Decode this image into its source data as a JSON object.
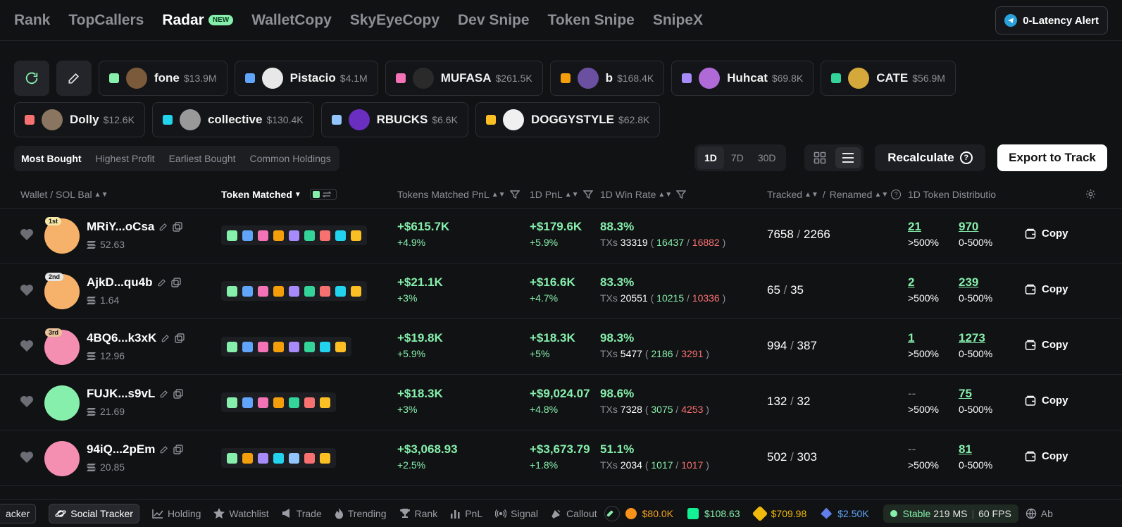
{
  "nav": {
    "items": [
      {
        "label": "Rank",
        "active": false
      },
      {
        "label": "TopCallers",
        "active": false
      },
      {
        "label": "Radar",
        "active": true,
        "badge": "NEW"
      },
      {
        "label": "WalletCopy",
        "active": false
      },
      {
        "label": "SkyEyeCopy",
        "active": false
      },
      {
        "label": "Dev Snipe",
        "active": false
      },
      {
        "label": "Token Snipe",
        "active": false
      },
      {
        "label": "SnipeX",
        "active": false
      }
    ],
    "alert_label": "0-Latency Alert"
  },
  "tokens": [
    {
      "name": "fone",
      "mc": "$13.9M",
      "color": "#86efac",
      "avatar": "#7a5a3a"
    },
    {
      "name": "Pistacio",
      "mc": "$4.1M",
      "color": "#60a5fa",
      "avatar": "#e8e8e8"
    },
    {
      "name": "MUFASA",
      "mc": "$261.5K",
      "color": "#f472b6",
      "avatar": "#2a2a2a"
    },
    {
      "name": "b",
      "mc": "$168.4K",
      "color": "#f59e0b",
      "avatar": "#6b4fa0"
    },
    {
      "name": "Huhcat",
      "mc": "$69.8K",
      "color": "#a78bfa",
      "avatar": "#b06ad8"
    },
    {
      "name": "CATE",
      "mc": "$56.9M",
      "color": "#34d399",
      "avatar": "#d4a83a"
    },
    {
      "name": "Dolly",
      "mc": "$12.6K",
      "color": "#f87171",
      "avatar": "#8a7560"
    },
    {
      "name": "collective",
      "mc": "$130.4K",
      "color": "#22d3ee",
      "avatar": "#999999"
    },
    {
      "name": "RBUCKS",
      "mc": "$6.6K",
      "color": "#93c5fd",
      "avatar": "#6a2fc0"
    },
    {
      "name": "DOGGYSTYLE",
      "mc": "$62.8K",
      "color": "#fbbf24",
      "avatar": "#f0f0f0"
    }
  ],
  "tabs": [
    "Most Bought",
    "Highest Profit",
    "Earliest Bought",
    "Common Holdings"
  ],
  "periods": [
    "1D",
    "7D",
    "30D"
  ],
  "recalculate_label": "Recalculate",
  "export_label": "Export to Track",
  "headers": {
    "wallet": "Wallet / SOL Bal",
    "token_matched": "Token Matched",
    "tm_pnl": "Tokens Matched PnL",
    "pnl_1d": "1D PnL",
    "win_rate": "1D Win Rate",
    "tracked": "Tracked",
    "renamed": "Renamed",
    "distribution": "1D Token Distributio"
  },
  "rows": [
    {
      "rank": "1st",
      "wallet": "MRiY...oCsa",
      "bal": "52.63",
      "avatar": "#f6b26b",
      "sq": 9,
      "tm_pnl": "+$615.7K",
      "tm_pct": "+4.9%",
      "pnl": "+$179.6K",
      "pnl_pct": "+5.9%",
      "win": "88.3%",
      "txs": "33319",
      "buy": "16437",
      "sell": "16882",
      "tracked": "7658",
      "renamed": "2266",
      "d1": "21",
      "d1_label": ">500%",
      "d2": "970",
      "d2_label": "0-500%"
    },
    {
      "rank": "2nd",
      "wallet": "AjkD...qu4b",
      "bal": "1.64",
      "avatar": "#f6b26b",
      "sq": 9,
      "tm_pnl": "+$21.1K",
      "tm_pct": "+3%",
      "pnl": "+$16.6K",
      "pnl_pct": "+4.7%",
      "win": "83.3%",
      "txs": "20551",
      "buy": "10215",
      "sell": "10336",
      "tracked": "65",
      "renamed": "35",
      "d1": "2",
      "d1_label": ">500%",
      "d2": "239",
      "d2_label": "0-500%"
    },
    {
      "rank": "3rd",
      "wallet": "4BQ6...k3xK",
      "bal": "12.96",
      "avatar": "#f48fb1",
      "sq": 8,
      "tm_pnl": "+$19.8K",
      "tm_pct": "+5.9%",
      "pnl": "+$18.3K",
      "pnl_pct": "+5%",
      "win": "98.3%",
      "txs": "5477",
      "buy": "2186",
      "sell": "3291",
      "tracked": "994",
      "renamed": "387",
      "d1": "1",
      "d1_label": ">500%",
      "d2": "1273",
      "d2_label": "0-500%"
    },
    {
      "rank": "",
      "wallet": "FUJK...s9vL",
      "bal": "21.69",
      "avatar": "#86efac",
      "sq": 7,
      "tm_pnl": "+$18.3K",
      "tm_pct": "+3%",
      "pnl": "+$9,024.07",
      "pnl_pct": "+4.8%",
      "win": "98.6%",
      "txs": "7328",
      "buy": "3075",
      "sell": "4253",
      "tracked": "132",
      "renamed": "32",
      "d1": "--",
      "d1_label": ">500%",
      "d2": "75",
      "d2_label": "0-500%"
    },
    {
      "rank": "",
      "wallet": "94iQ...2pEm",
      "bal": "20.85",
      "avatar": "#f48fb1",
      "sq": 7,
      "tm_pnl": "+$3,068.93",
      "tm_pct": "+2.5%",
      "pnl": "+$3,673.79",
      "pnl_pct": "+1.8%",
      "win": "51.1%",
      "txs": "2034",
      "buy": "1017",
      "sell": "1017",
      "tracked": "502",
      "renamed": "303",
      "d1": "--",
      "d1_label": ">500%",
      "d2": "81",
      "d2_label": "0-500%"
    }
  ],
  "txs_prefix": "TXs",
  "copy_label": "Copy",
  "row_square_sets": [
    [
      "#86efac",
      "#60a5fa",
      "#f472b6",
      "#f59e0b",
      "#a78bfa",
      "#34d399",
      "#f87171",
      "#22d3ee",
      "#fbbf24"
    ],
    [
      "#86efac",
      "#60a5fa",
      "#f472b6",
      "#f59e0b",
      "#a78bfa",
      "#34d399",
      "#f87171",
      "#22d3ee",
      "#fbbf24"
    ],
    [
      "#86efac",
      "#60a5fa",
      "#f472b6",
      "#f59e0b",
      "#a78bfa",
      "#34d399",
      "#22d3ee",
      "#fbbf24"
    ],
    [
      "#86efac",
      "#60a5fa",
      "#f472b6",
      "#f59e0b",
      "#34d399",
      "#f87171",
      "#fbbf24"
    ],
    [
      "#86efac",
      "#f59e0b",
      "#a78bfa",
      "#22d3ee",
      "#93c5fd",
      "#f87171",
      "#fbbf24"
    ]
  ],
  "bottom": {
    "items": [
      "acker",
      "Social Tracker",
      "Holding",
      "Watchlist",
      "Trade",
      "Trending",
      "Rank",
      "PnL",
      "Signal",
      "Callout"
    ],
    "prices": [
      {
        "value": "$80.0K",
        "color": "#f7931a",
        "text_color": "#f5a623"
      },
      {
        "value": "$108.63",
        "color": "#14f195",
        "text_color": "#86efac"
      },
      {
        "value": "$709.98",
        "color": "#f0b90b",
        "text_color": "#f0b90b"
      },
      {
        "value": "$2.50K",
        "color": "#627eea",
        "text_color": "#60a5fa"
      }
    ],
    "status": "Stable",
    "latency": "219 MS",
    "fps": "60 FPS",
    "tail": "Ab"
  }
}
